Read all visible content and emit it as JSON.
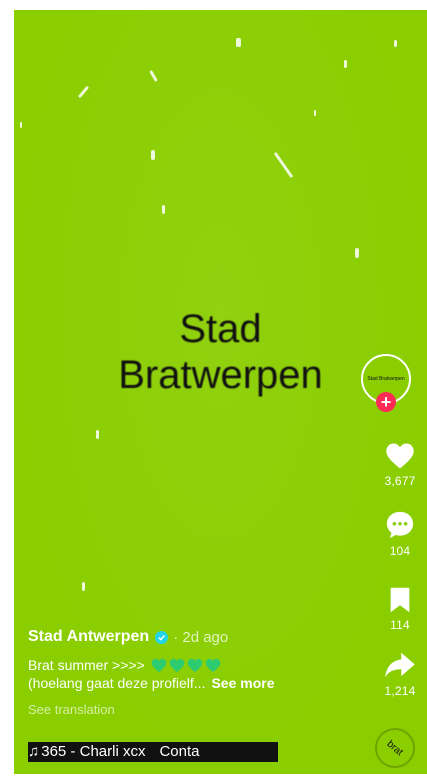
{
  "video": {
    "title_line1": "Stad",
    "title_line2": "Bratwerpen",
    "background_color": "#8ACE00"
  },
  "creator": {
    "avatar_text": "Stad Bratwerpen",
    "follow_symbol": "+"
  },
  "actions": {
    "likes": "3,677",
    "comments": "104",
    "saves": "114",
    "shares": "1,214"
  },
  "caption": {
    "username": "Stad Antwerpen",
    "time_ago": "· 2d ago",
    "line1": "Brat summer >>>>",
    "line2": "(hoelang gaat deze profielf...",
    "see_more": "See more",
    "see_translation": "See translation",
    "hearts_count": 4,
    "heart_color": "#2ECC71"
  },
  "music": {
    "note_icon": "music-note-icon",
    "track": "365 - Charli xcx",
    "continued": "Conta"
  },
  "disc": {
    "label": "brat"
  },
  "colors": {
    "follow_red": "#FE2C55",
    "verified_blue": "#20D5EC"
  }
}
